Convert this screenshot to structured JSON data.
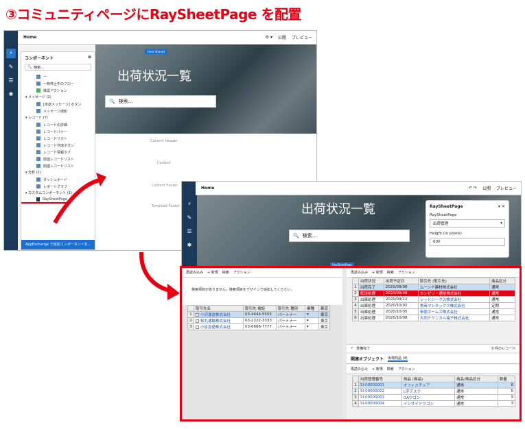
{
  "title": "③コミュニティページにRaySheetPage を配置",
  "shot1": {
    "page": "Home",
    "publish": "公開",
    "preview": "プレビュー",
    "hero_title": "出荷状況一覧",
    "search_placeholder": "検索...",
    "badge": "Hero  Shared",
    "panel": {
      "title": "コンポーネント",
      "search_placeholder": "検索...",
      "items_top": [
        "ー",
        "一時停止中のフロー",
        "推奨アクション"
      ],
      "sec_message": "メッセージ (2)",
      "message_items": [
        "[未読メッセージ] ボタン",
        "メッセージ通知"
      ],
      "sec_record": "レコード (7)",
      "record_items": [
        "レコードの詳細",
        "レコードバナー",
        "レコードリスト",
        "レコード作成ボタン",
        "レコード情報タブ",
        "関連レコードリスト",
        "関連レコードリスト"
      ],
      "sec_analysis": "分析 (2)",
      "analysis_items": [
        "ダッシュボード",
        "レポートグラフ"
      ],
      "sec_custom": "カスタムコンポーネント (1)",
      "custom_items": [
        "RaySheetPage"
      ],
      "footer": "AppExchange で追加コンポーネントを..."
    },
    "zones": [
      "Content Header",
      "Content",
      "Content Footer",
      "Template Footer"
    ]
  },
  "shot2": {
    "page": "Home",
    "publish": "公開",
    "preview": "プレビュー",
    "hero_title": "出荷状況一覧",
    "search_placeholder": "検索...",
    "tag": "RaySheetPage",
    "prop": {
      "title": "RaySheetPage",
      "label1": "RaySheetPage",
      "value1": "出荷管理",
      "label2": "Height (in pixels)",
      "value2": "600"
    }
  },
  "grid_left": {
    "toolbar": [
      "再読み込み",
      "+ 新規",
      "検索",
      "アクション"
    ],
    "msg": "検索項目がありません。検索項目をデザインで追加してください。",
    "headers": [
      "取引先名",
      "取引先 電話",
      "取引先 種別",
      "業種",
      "都道"
    ],
    "rows": [
      [
        "1",
        "小沢運送株式会社",
        "03-4444-5555",
        "パートナー",
        "東京"
      ],
      [
        "2",
        "松丸運輸株式会社",
        "03-2222-3333",
        "パートナー",
        "東京"
      ],
      [
        "3",
        "小谷急便株式会社",
        "03-6666-7777",
        "パートナー",
        "東京"
      ]
    ]
  },
  "grid_right": {
    "toolbar": [
      "再読み込み",
      "+ 新規",
      "検索",
      "アクション"
    ],
    "headers": [
      "出荷状況",
      "出荷予定日",
      "取引先 (取引先)",
      "商品区分"
    ],
    "rows": [
      [
        "1",
        "出荷完了",
        "2020/09/08",
        "ムーンド建材株式会社",
        "通常"
      ],
      [
        "2",
        "配送処理",
        "2020/09/08",
        "カンゼリー通信株式会社",
        "通常"
      ],
      [
        "3",
        "出庫処理",
        "2020/09/12",
        "レッドジークス株式会社",
        "通常"
      ],
      [
        "4",
        "出庫処理",
        "2020/10/02",
        "角商マシネックス株式会社",
        "定期"
      ],
      [
        "5",
        "出庫処理",
        "2020/10/05",
        "帝徳ホームズ株式会社",
        "通常"
      ],
      [
        "6",
        "出庫処理",
        "2020/10/08",
        "大同テクニカル電子株式会社",
        "通常"
      ]
    ],
    "status": "準備完了",
    "count": "9 件のレコード",
    "related_title": "関連オブジェクト",
    "related_tab": "出荷商品 (4)",
    "sub_headers": [
      "出荷管理番号",
      "商品 (商品)",
      "商品/商品区分",
      "数量"
    ],
    "sub_rows": [
      [
        "1",
        "SI-00000001",
        "オフィスチェア",
        "通常",
        "8"
      ],
      [
        "2",
        "SI-00000002",
        "L字デスク",
        "通常",
        "5"
      ],
      [
        "3",
        "SI-00000003",
        "OAワゴン",
        "通常",
        "3"
      ],
      [
        "4",
        "SI-00000004",
        "インサイドワゴン",
        "通常",
        "3"
      ]
    ]
  },
  "colors": {
    "accent": "#e60012",
    "rail": "#1b3a5a",
    "link": "#1a4fa3"
  }
}
